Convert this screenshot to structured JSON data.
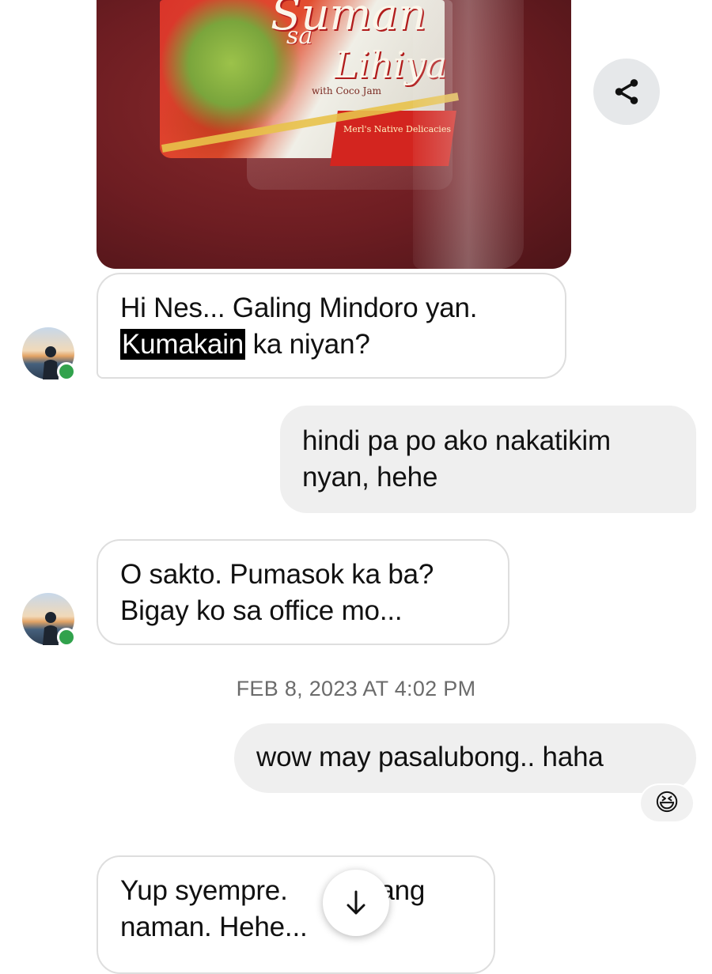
{
  "messages": [
    {
      "direction": "incoming",
      "text_line1": "Hi Nes... Galing Mindoro yan.",
      "text_highlight": "Kumakain",
      "text_line2_rest": " ka niyan?"
    },
    {
      "direction": "outgoing",
      "text_line1": "hindi pa po ako nakatikim",
      "text_line2": "nyan, hehe"
    },
    {
      "direction": "incoming",
      "text_line1": "O sakto. Pumasok ka ba?",
      "text_line2": "Bigay ko sa office mo..."
    },
    {
      "direction": "outgoing",
      "text_line1": "wow may pasalubong.. haha",
      "reaction": "😆"
    },
    {
      "direction": "incoming",
      "text_line1_a": "Yup syempre. ",
      "text_line1_b": "ti lang",
      "text_line2": "naman. Hehe..."
    }
  ],
  "timestamp": "FEB 8, 2023 AT 4:02 PM",
  "photo": {
    "brand_line1": "Suman",
    "brand_line2": "sa",
    "brand_line3": "Lihiya",
    "sub": "with Coco Jam",
    "maker": "Merl's Native Delicacies"
  },
  "icons": {
    "share": "share-icon",
    "scroll_down": "arrow-down-icon"
  },
  "colors": {
    "online": "#31a24c",
    "outgoing_bubble": "#efefef",
    "incoming_border": "#dedede"
  }
}
